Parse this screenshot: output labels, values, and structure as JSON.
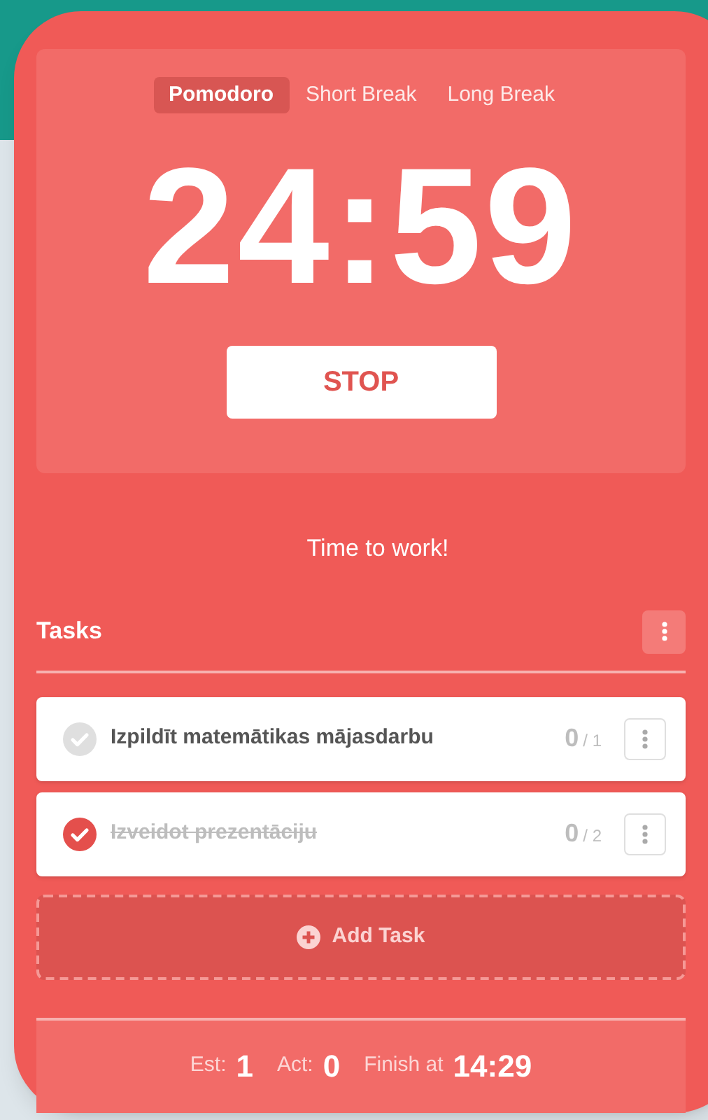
{
  "modes": [
    {
      "label": "Pomodoro",
      "selected": true
    },
    {
      "label": "Short Break",
      "selected": false
    },
    {
      "label": "Long Break",
      "selected": false
    }
  ],
  "timer": "24:59",
  "action_button": "STOP",
  "message": "Time to work!",
  "tasks_title": "Tasks",
  "tasks": [
    {
      "title": "Izpildīt matemātikas mājasdarbu",
      "done": false,
      "act": "0",
      "est": "/ 1"
    },
    {
      "title": "Izveidot prezentāciju",
      "done": true,
      "act": "0",
      "est": "/ 2"
    }
  ],
  "add_task": "Add Task",
  "footer": {
    "est_label": "Est:",
    "est": "1",
    "act_label": "Act:",
    "act": "0",
    "finish_label": "Finish at",
    "finish": "14:29"
  }
}
